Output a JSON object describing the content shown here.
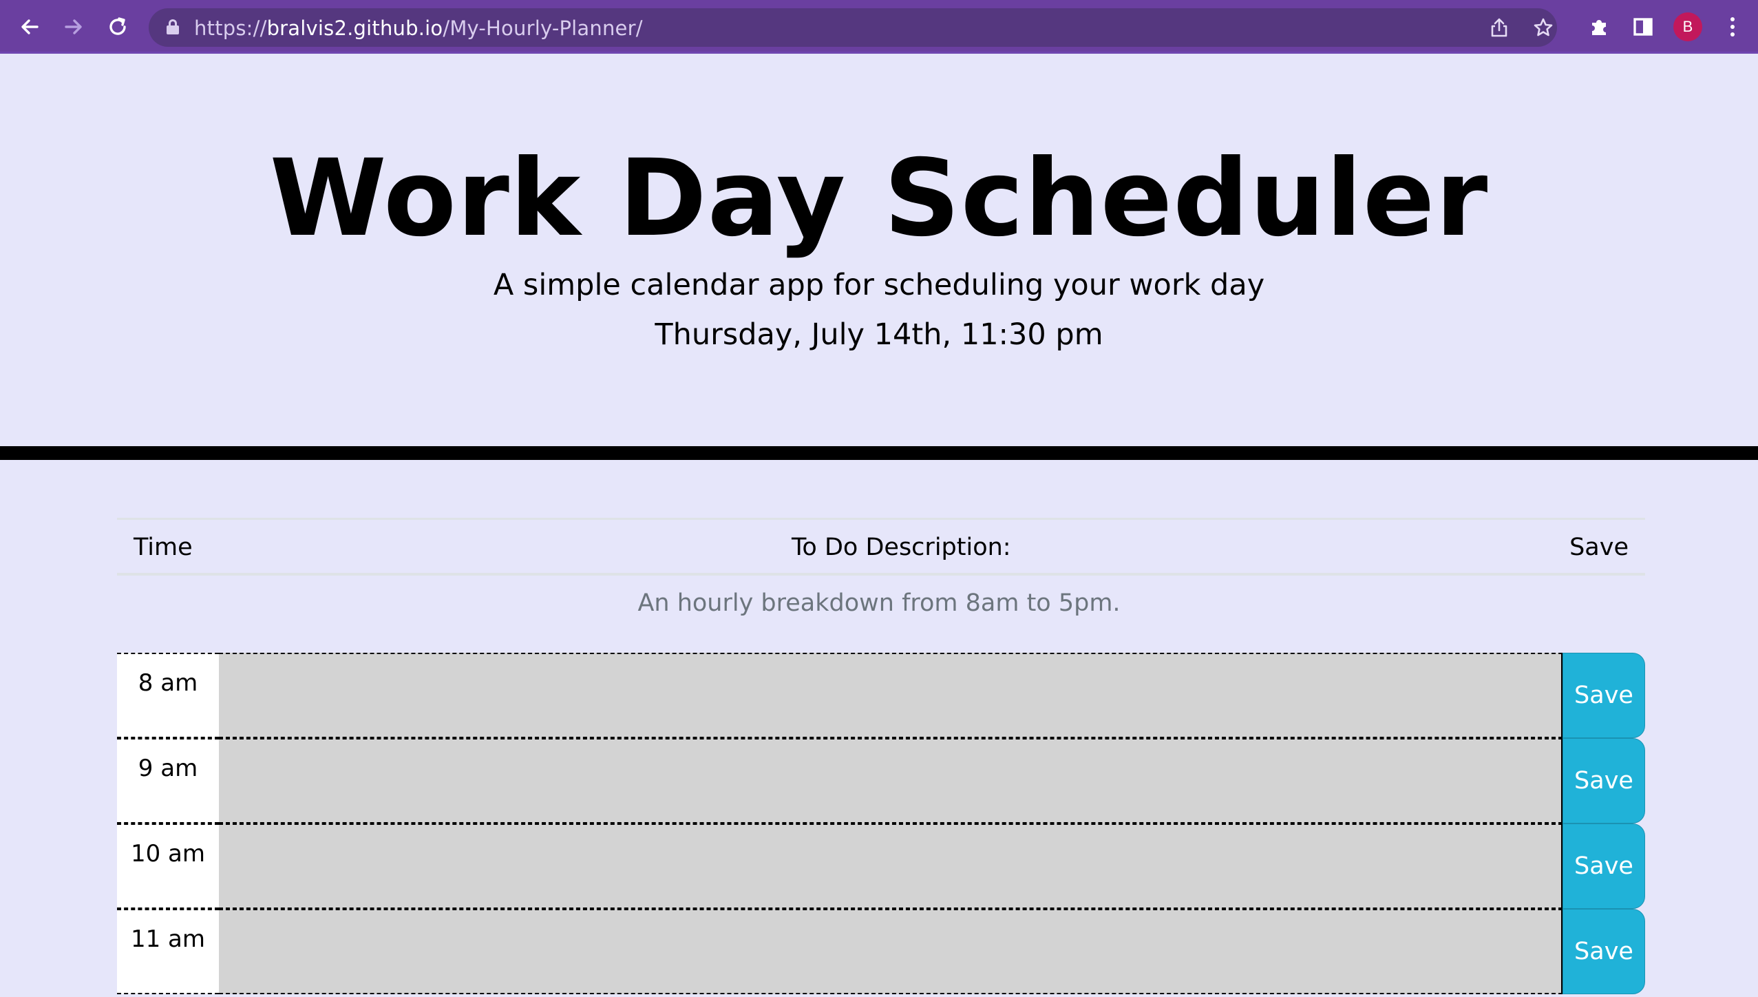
{
  "browser": {
    "url_scheme": "https://",
    "url_host": "bralvis2.github.io",
    "url_path": "/My-Hourly-Planner/",
    "profile_initial": "B",
    "icons": [
      "back-arrow-icon",
      "forward-arrow-icon",
      "reload-icon",
      "lock-icon",
      "share-icon",
      "star-icon",
      "extensions-icon",
      "side-panel-icon",
      "more-menu-icon"
    ]
  },
  "header": {
    "title": "Work Day Scheduler",
    "lead": "A simple calendar app for scheduling your work day",
    "current_day": "Thursday, July 14th, 11:30 pm"
  },
  "table": {
    "columns": [
      "Time",
      "To Do Description:",
      "Save"
    ],
    "caption": "An hourly breakdown from 8am to 5pm.",
    "rows": [
      {
        "hour": "8 am",
        "description": "",
        "save_label": "Save"
      },
      {
        "hour": "9 am",
        "description": "",
        "save_label": "Save"
      },
      {
        "hour": "10 am",
        "description": "",
        "save_label": "Save"
      },
      {
        "hour": "11 am",
        "description": "",
        "save_label": "Save"
      }
    ]
  },
  "colors": {
    "chrome": "#6a3fa0",
    "page_background": "#e6e6fa",
    "past_row": "#d3d3d3",
    "save_button": "#20b2d8"
  }
}
